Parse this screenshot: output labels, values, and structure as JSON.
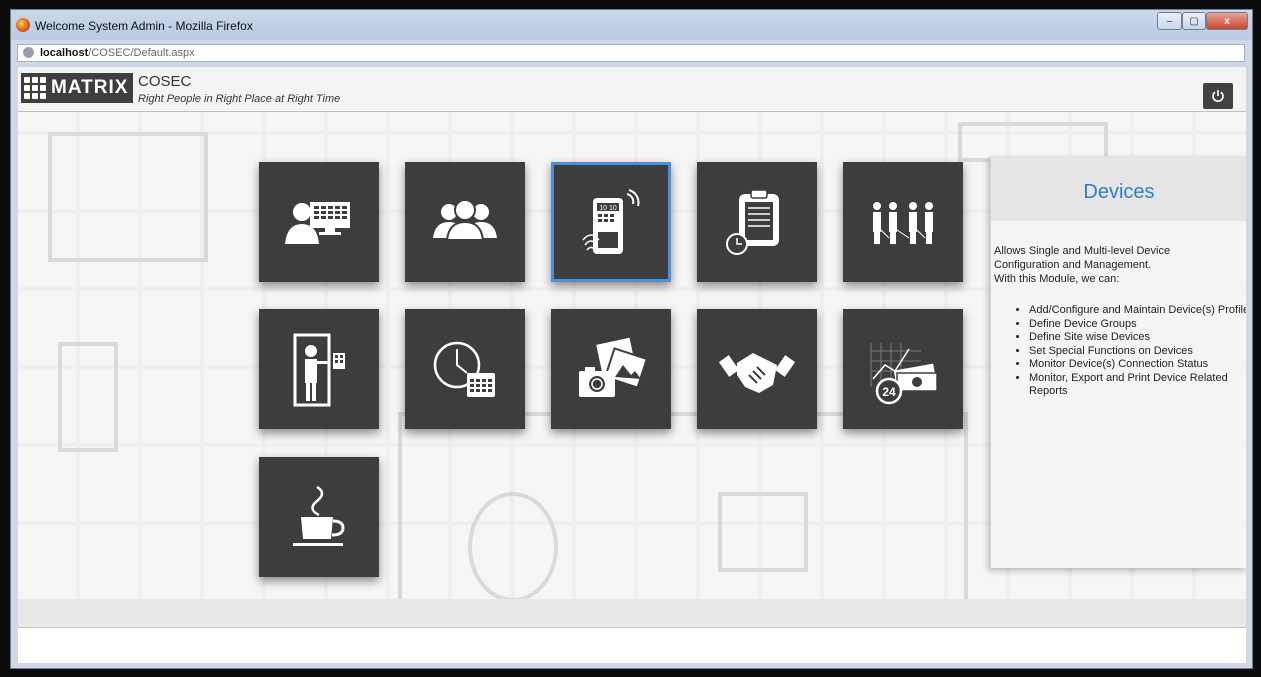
{
  "window": {
    "title": "Welcome System Admin - Mozilla Firefox",
    "minimize": "–",
    "maximize": "▢",
    "close": "x"
  },
  "address": {
    "host": "localhost",
    "path": "/COSEC/Default.aspx"
  },
  "header": {
    "logo_text": "MATRIX",
    "product": "COSEC",
    "tagline": "Right People in Right Place at Right Time"
  },
  "tiles": [
    {
      "icon": "admin-console-icon"
    },
    {
      "icon": "users-group-icon"
    },
    {
      "icon": "device-fingerprint-icon",
      "selected": true
    },
    {
      "icon": "clipboard-clock-icon"
    },
    {
      "icon": "people-organization-icon"
    },
    {
      "icon": "door-access-keypad-icon"
    },
    {
      "icon": "clock-calendar-icon"
    },
    {
      "icon": "camera-photos-icon"
    },
    {
      "icon": "handshake-icon"
    },
    {
      "icon": "money-chart-24-icon"
    },
    {
      "icon": "coffee-cup-icon"
    }
  ],
  "info": {
    "title": "Devices",
    "description": [
      "Allows Single and Multi-level Device",
      "Configuration and Management.",
      "With this Module, we can:"
    ],
    "items": [
      "Add/Configure and Maintain Device(s) Profile",
      "Define Device Groups",
      "Define Site wise Devices",
      "Set Special Functions on Devices",
      "Monitor Device(s) Connection Status",
      "Monitor, Export and Print Device Related Reports"
    ]
  },
  "colors": {
    "accent": "#2d7ec8",
    "tile": "#3d3d3d",
    "selected_border": "#4a90d9"
  }
}
